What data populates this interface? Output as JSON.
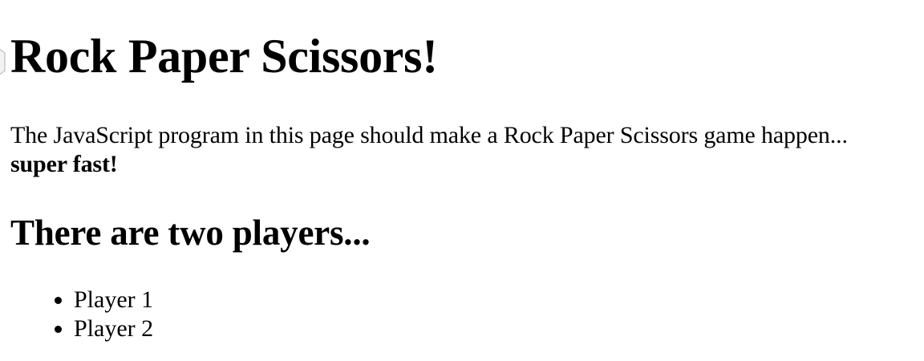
{
  "page": {
    "title": "Rock Paper Scissors!",
    "intro_text": "The JavaScript program in this page should make a Rock Paper Scissors game happen...",
    "intro_emphasis": "super fast!",
    "players_heading": "There are two players...",
    "players": [
      {
        "label": "Player 1"
      },
      {
        "label": "Player 2"
      }
    ]
  },
  "icons": {
    "edge_icon": "partial-hexagon-icon"
  }
}
